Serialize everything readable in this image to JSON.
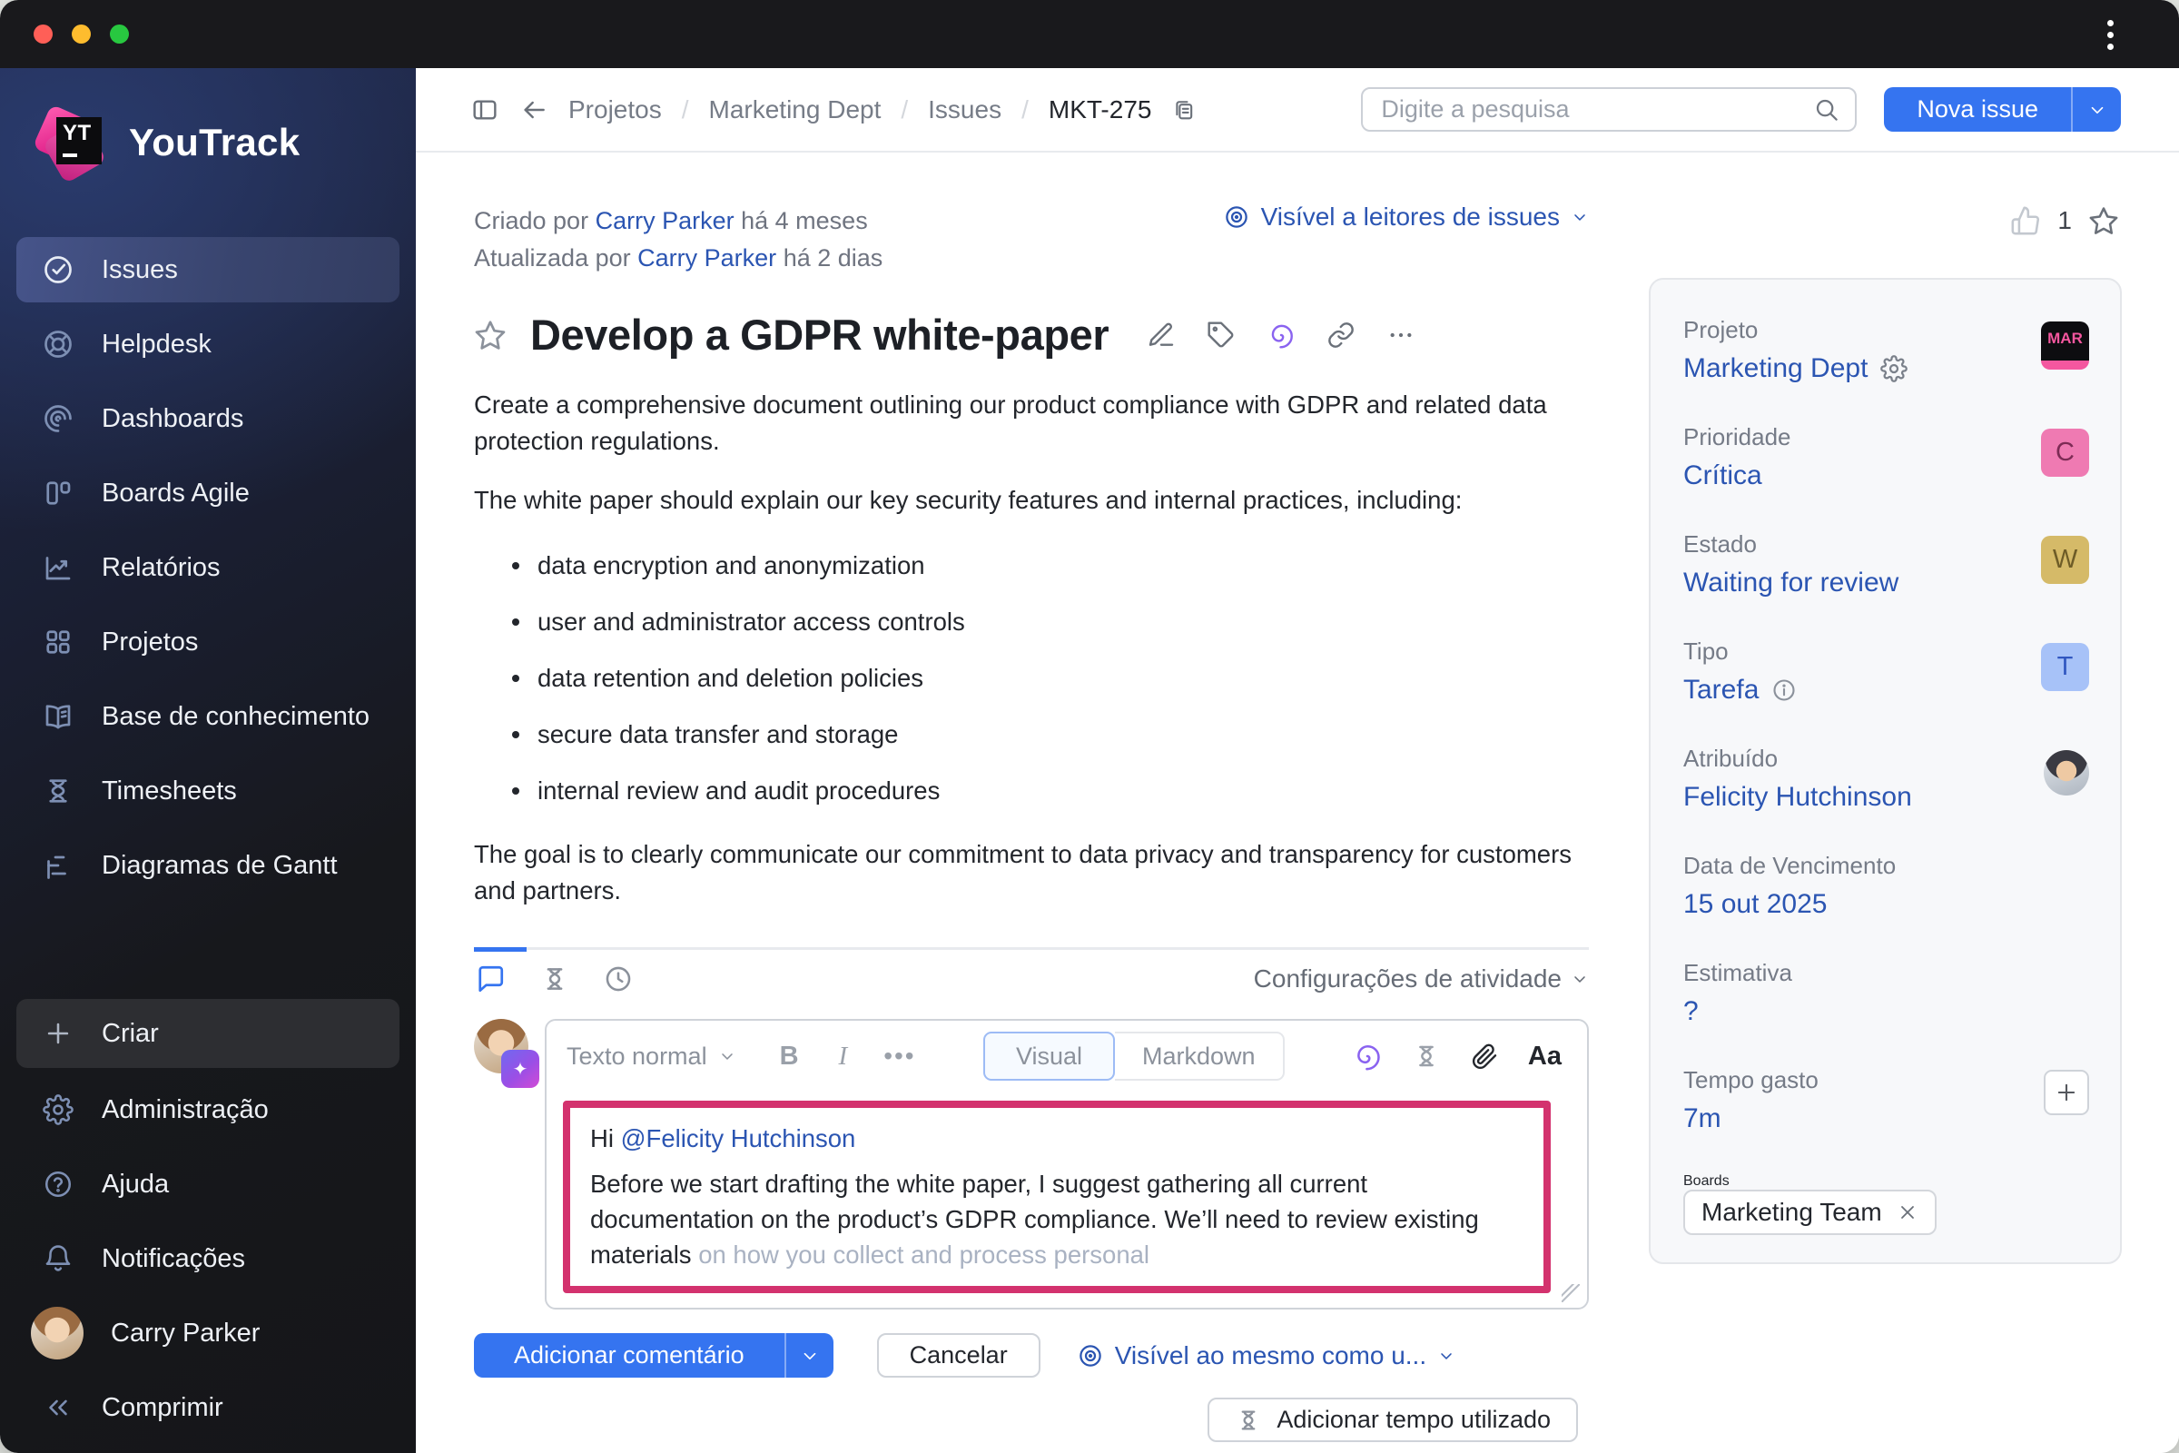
{
  "colors": {
    "accent_blue": "#3574f0",
    "link_blue": "#2b55b2",
    "comment_highlight_border": "#d3326e",
    "sidebar_top": "#20294c",
    "panel_bg": "#f7f8fa",
    "priority_badge_bg": "#ef7ab2",
    "state_badge_bg": "#d5ba68",
    "type_badge_bg": "#a7c2f8",
    "project_badge_accent": "#f4579f",
    "traffic_close": "#ff5f57",
    "traffic_minimize": "#febc2e",
    "traffic_zoom": "#28c840"
  },
  "icons": {
    "window_menu": "kebab-vertical",
    "collapse_panel": "panel-left",
    "back": "arrow-left",
    "copy_issue_id": "copy",
    "search": "magnifier",
    "visibility": "target-eye",
    "like": "thumb-up",
    "favorite": "star",
    "edit": "pencil",
    "tags": "tag",
    "ai_assistant": "purple-spiral",
    "link": "chain",
    "more": "ellipsis",
    "comments_tab": "speech-bubble",
    "spent_time": "hourglass",
    "history_tab": "clock",
    "attach": "paperclip",
    "settings": "gear",
    "info": "info-circle",
    "add": "plus",
    "remove": "x"
  },
  "sidebar": {
    "logo_monogram": "YT",
    "logo_text": "YouTrack",
    "items": [
      "Issues",
      "Helpdesk",
      "Dashboards",
      "Boards Agile",
      "Relatórios",
      "Projetos",
      "Base de conhecimento",
      "Timesheets",
      "Diagramas de Gantt"
    ],
    "create_label": "Criar",
    "admin_label": "Administração",
    "help_label": "Ajuda",
    "notifications_label": "Notificações",
    "user_name": "Carry Parker",
    "collapse_label": "Comprimir"
  },
  "header": {
    "breadcrumb": [
      "Projetos",
      "Marketing Dept",
      "Issues",
      "MKT-275"
    ],
    "search_placeholder": "Digite a pesquisa",
    "new_issue_label": "Nova issue"
  },
  "issue": {
    "created_prefix": "Criado por",
    "created_user": "Carry Parker",
    "created_suffix": "há 4 meses",
    "updated_prefix": "Atualizada por",
    "updated_user": "Carry Parker",
    "updated_suffix": "há 2 dias",
    "visibility_label": "Visível a leitores de issues",
    "likes_count": "1",
    "title": "Develop a GDPR white-paper",
    "description": {
      "para1": "Create a comprehensive document outlining our product compliance with GDPR and related data protection regulations.",
      "para2": "The white paper should explain our key security features and internal practices, including:",
      "bullets": [
        "data encryption and anonymization",
        "user and administrator access controls",
        "data retention and deletion policies",
        "secure data transfer and storage",
        "internal review and audit procedures"
      ],
      "para3": "The goal is to clearly communicate our commitment to data privacy and transparency for customers and partners."
    }
  },
  "activity": {
    "settings_label": "Configurações de atividade"
  },
  "editor": {
    "paragraph_style": "Texto normal",
    "bold_label": "B",
    "italic_label": "I",
    "more_label": "•••",
    "visual_label": "Visual",
    "markdown_label": "Markdown",
    "format_label": "Aa",
    "comment_greeting": "Hi ",
    "comment_mention": "@Felicity Hutchinson",
    "comment_body": "Before we start drafting the white paper, I suggest gathering all current documentation on the product’s GDPR compliance. We’ll need to review existing materials",
    "comment_suggestion": " on how you collect and process personal",
    "add_comment_label": "Adicionar comentário",
    "cancel_label": "Cancelar",
    "visibility_label": "Visível ao mesmo como u...",
    "add_time_label": "Adicionar tempo utilizado"
  },
  "panel": {
    "project": {
      "label": "Projeto",
      "value": "Marketing Dept",
      "badge": "MAR"
    },
    "priority": {
      "label": "Prioridade",
      "value": "Crítica",
      "badge": "C"
    },
    "state": {
      "label": "Estado",
      "value": "Waiting for review",
      "badge": "W"
    },
    "type": {
      "label": "Tipo",
      "value": "Tarefa",
      "badge": "T"
    },
    "assignee": {
      "label": "Atribuído",
      "value": "Felicity Hutchinson"
    },
    "due": {
      "label": "Data de Vencimento",
      "value": "15 out 2025"
    },
    "estimate": {
      "label": "Estimativa",
      "value": "?"
    },
    "spent": {
      "label": "Tempo gasto",
      "value": "7m"
    },
    "boards": {
      "label": "Boards",
      "chip": "Marketing Team"
    }
  }
}
